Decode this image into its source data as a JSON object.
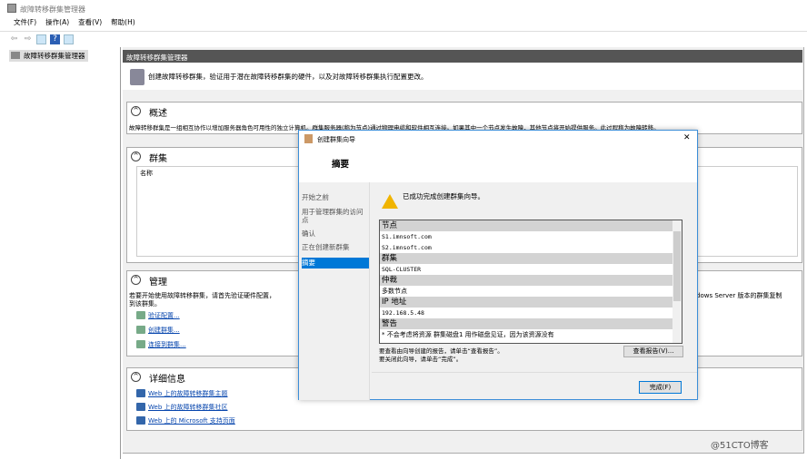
{
  "window": {
    "title": "故障转移群集管理器"
  },
  "menu": [
    "文件(F)",
    "操作(A)",
    "查看(V)",
    "帮助(H)"
  ],
  "tree": {
    "root": "故障转移群集管理器"
  },
  "main": {
    "header": "故障转移群集管理器",
    "intro": "创建故障转移群集，验证用于潜在故障转移群集的硬件，以及对故障转移群集执行配置更改。",
    "overview": {
      "title": "概述",
      "text": "故障转移群集是一组相互协作以增加服务器角色可用性的独立计算机。群集服务器(称为节点)通过物理电缆和软件相互连接。如果其中一个节点发生故障，其他节点将开始提供服务。此过程称为故障转移。"
    },
    "clusters": {
      "title": "群集",
      "column": "名称"
    },
    "manage": {
      "title": "管理",
      "text1": "若要开始使用故障转移群集，请首先验证硬件配置，",
      "text2": "到该群集。",
      "text_right": "dows Server 版本的群集复制",
      "links": [
        "验证配置...",
        "创建群集...",
        "连接到群集..."
      ]
    },
    "details": {
      "title": "详细信息",
      "links": [
        "Web 上的故障转移群集主题",
        "Web 上的故障转移群集社区",
        "Web 上的 Microsoft 支持页面"
      ]
    }
  },
  "dialog": {
    "title": "创建群集向导",
    "heading": "摘要",
    "nav": [
      "开始之前",
      "用于管理群集的访问点",
      "确认",
      "正在创建新群集",
      "摘要"
    ],
    "message": "已成功完成创建群集向导。",
    "sections": [
      {
        "header": "节点",
        "rows": [
          "S1.imnsoft.com",
          "S2.imnsoft.com"
        ]
      },
      {
        "header": "群集",
        "rows": [
          "SQL-CLUSTER"
        ]
      },
      {
        "header": "仲裁",
        "rows": [
          "多数节点"
        ]
      },
      {
        "header": "IP 地址",
        "rows": [
          "192.168.5.48"
        ]
      },
      {
        "header": "警告",
        "rows": [
          "* 不会考虑将资源 群集磁盘1 用作磁盘见证，因为该资源没有"
        ]
      }
    ],
    "hint1": "要查看由向导创建的报告，请单击“查看报告”。",
    "hint2": "要关闭此向导，请单击“完成”。",
    "view_report": "查看报告(V)...",
    "finish": "完成(F)",
    "close": "✕"
  },
  "watermark": "@51CTO博客"
}
